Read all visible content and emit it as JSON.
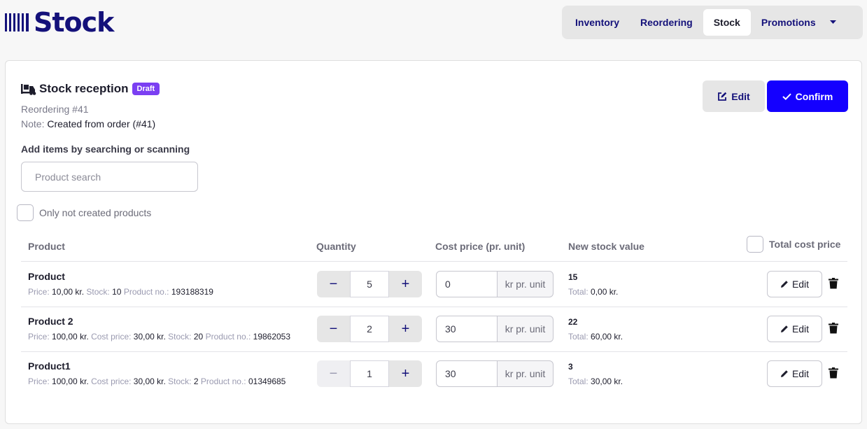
{
  "app": {
    "logo_text": "Stock"
  },
  "nav": {
    "tabs": [
      {
        "label": "Inventory",
        "active": false
      },
      {
        "label": "Reordering",
        "active": false
      },
      {
        "label": "Stock",
        "active": true
      },
      {
        "label": "Promotions",
        "active": false
      }
    ],
    "more_icon": "chevron-down-icon"
  },
  "header": {
    "title": "Stock reception",
    "status_badge": "Draft",
    "reordering": "Reordering #41",
    "note_label": "Note:",
    "note_value": "Created from order (#41)",
    "edit_label": "Edit",
    "confirm_label": "Confirm"
  },
  "search": {
    "label": "Add items by searching or scanning",
    "placeholder": "Product search",
    "value": ""
  },
  "filter": {
    "label": "Only not created products",
    "checked": false
  },
  "table": {
    "headers": {
      "product": "Product",
      "quantity": "Quantity",
      "cost_price": "Cost price (pr. unit)",
      "new_stock_value": "New stock value",
      "total_cost_price": "Total cost price"
    },
    "unit_label": "kr pr. unit",
    "row_edit_label": "Edit",
    "rows": [
      {
        "name": "Product",
        "price": "10,00 kr.",
        "stock": "10",
        "product_no": "193188319",
        "quantity": "5",
        "cost_price": "0",
        "new_stock": "15",
        "total": "0,00 kr."
      },
      {
        "name": "Product 2",
        "price": "100,00 kr.",
        "cost_price_label_value": "30,00 kr.",
        "stock": "20",
        "product_no": "19862053",
        "quantity": "2",
        "cost_price": "30",
        "new_stock": "22",
        "total": "60,00 kr."
      },
      {
        "name": "Product1",
        "price": "100,00 kr.",
        "cost_price_label_value": "30,00 kr.",
        "stock": "2",
        "product_no": "01349685",
        "quantity": "1",
        "cost_price": "30",
        "new_stock": "3",
        "total": "30,00 kr."
      }
    ]
  },
  "labels": {
    "price": "Price:",
    "cost_price": "Cost price:",
    "stock": "Stock:",
    "product_no": "Product no.:",
    "total": "Total:"
  },
  "colors": {
    "brand": "#14117a",
    "confirm": "#1400ff",
    "draft_badge": "#7b3ff2"
  }
}
